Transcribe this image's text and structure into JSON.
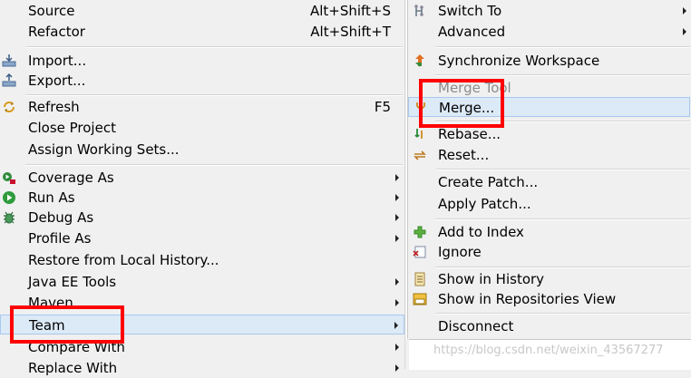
{
  "left_menu": {
    "source": {
      "label": "Source",
      "shortcut": "Alt+Shift+S"
    },
    "refactor": {
      "label": "Refactor",
      "shortcut": "Alt+Shift+T"
    },
    "import": {
      "label": "Import..."
    },
    "export": {
      "label": "Export..."
    },
    "refresh": {
      "label": "Refresh",
      "shortcut": "F5"
    },
    "close_project": {
      "label": "Close Project"
    },
    "assign_working_sets": {
      "label": "Assign Working Sets..."
    },
    "coverage_as": {
      "label": "Coverage As"
    },
    "run_as": {
      "label": "Run As"
    },
    "debug_as": {
      "label": "Debug As"
    },
    "profile_as": {
      "label": "Profile As"
    },
    "restore_local_history": {
      "label": "Restore from Local History..."
    },
    "java_ee_tools": {
      "label": "Java EE Tools"
    },
    "maven": {
      "label": "Maven"
    },
    "team": {
      "label": "Team"
    },
    "compare_with": {
      "label": "Compare With"
    },
    "replace_with": {
      "label": "Replace With"
    }
  },
  "right_menu": {
    "switch_to": {
      "label": "Switch To"
    },
    "advanced": {
      "label": "Advanced"
    },
    "synchronize_workspace": {
      "label": "Synchronize Workspace"
    },
    "merge_tool": {
      "label": "Merge Tool"
    },
    "merge": {
      "label": "Merge..."
    },
    "rebase": {
      "label": "Rebase..."
    },
    "reset": {
      "label": "Reset..."
    },
    "create_patch": {
      "label": "Create Patch..."
    },
    "apply_patch": {
      "label": "Apply Patch..."
    },
    "add_to_index": {
      "label": "Add to Index"
    },
    "ignore": {
      "label": "Ignore"
    },
    "show_in_history": {
      "label": "Show in History"
    },
    "show_in_repositories_view": {
      "label": "Show in Repositories View"
    },
    "disconnect": {
      "label": "Disconnect"
    }
  },
  "watermark": "https://blog.csdn.net/weixin_43567277",
  "colors": {
    "highlight_box": "#ff0000",
    "hover_background": "#dce9f7",
    "menu_background": "#f0f0f0"
  }
}
